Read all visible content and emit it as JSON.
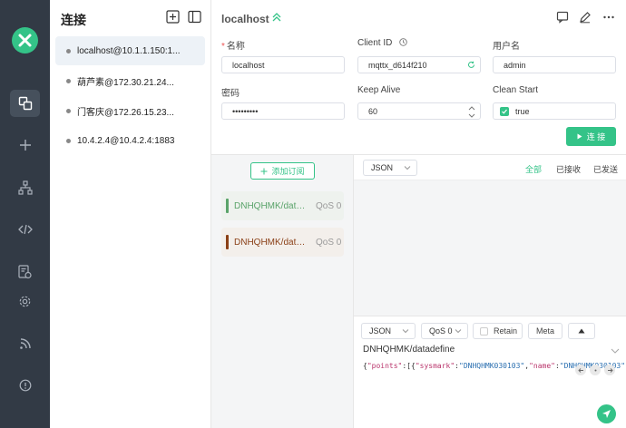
{
  "sidebar": {
    "title": "连接",
    "connections": [
      {
        "label": "localhost@10.1.1.150:1..."
      },
      {
        "label": "葫芦素@172.30.21.24..."
      },
      {
        "label": "门客庆@172.26.15.23..."
      },
      {
        "label": "10.4.2.4@10.4.2.4:1883"
      }
    ]
  },
  "header": {
    "host": "localhost"
  },
  "form": {
    "name_label": "名称",
    "name_value": "localhost",
    "client_id_label": "Client ID",
    "client_id_value": "mqttx_d614f210",
    "username_label": "用户名",
    "username_value": "admin",
    "password_label": "密码",
    "password_value": "•••••••••",
    "keepalive_label": "Keep Alive",
    "keepalive_value": "60",
    "clean_start_label": "Clean Start",
    "clean_start_value": "true",
    "connect_label": "连 接"
  },
  "subscriptions": {
    "add_label": "添加订阅",
    "items": [
      {
        "topic": "DNHQHMK/datadefine",
        "qos": "QoS 0",
        "color": "#5aa36a",
        "bg": "#eef2ee"
      },
      {
        "topic": "DNHQHMK/datadefine",
        "qos": "QoS 0",
        "color": "#8a3f16",
        "bg": "#f3efeb"
      }
    ]
  },
  "messages": {
    "format": "JSON",
    "filters": {
      "all": "全部",
      "received": "已接收",
      "sent": "已发送"
    }
  },
  "composer": {
    "format": "JSON",
    "qos": "QoS 0",
    "retain_label": "Retain",
    "meta_label": "Meta",
    "topic": "DNHQHMK/datadefine",
    "payload_parts": [
      "{",
      "\"points\"",
      ":[{",
      "\"sysmark\"",
      ":",
      "\"DNHQHMK030103\"",
      ",",
      "\"name\"",
      ":",
      "\"DNHQHMK030103\"",
      "..."
    ]
  },
  "colors": {
    "accent": "#34c388",
    "rail": "#323a45"
  }
}
